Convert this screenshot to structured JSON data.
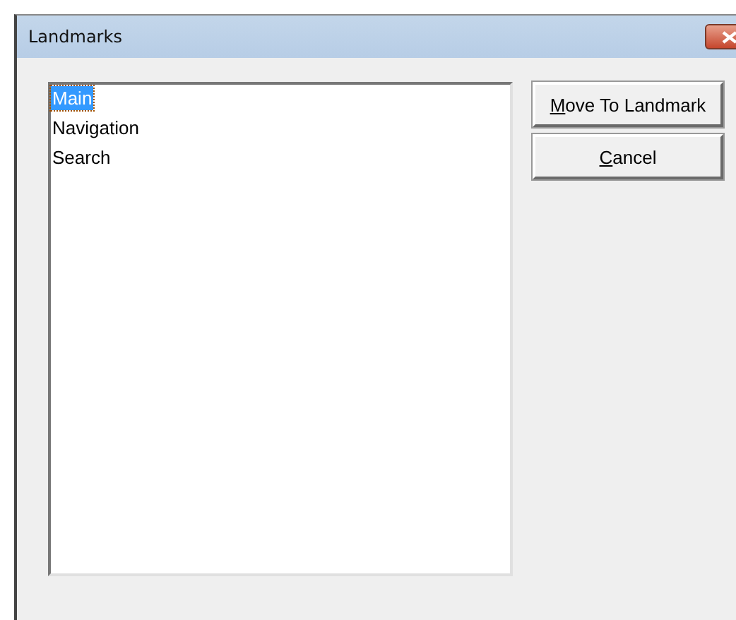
{
  "window": {
    "title": "Landmarks"
  },
  "list": {
    "items": [
      {
        "label": "Main",
        "selected": true
      },
      {
        "label": "Navigation",
        "selected": false
      },
      {
        "label": "Search",
        "selected": false
      }
    ]
  },
  "buttons": [
    {
      "access_key": "M",
      "rest": "ove To Landmark"
    },
    {
      "access_key": "C",
      "rest": "ancel"
    }
  ]
}
